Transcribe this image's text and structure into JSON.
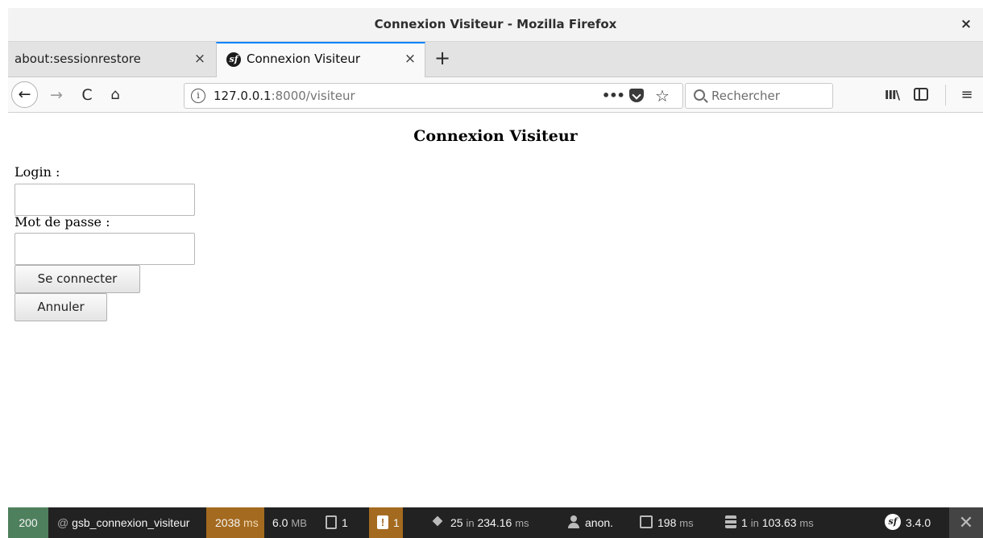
{
  "window": {
    "title": "Connexion Visiteur - Mozilla Firefox",
    "close_glyph": "×"
  },
  "tabs": [
    {
      "label": "about:sessionrestore",
      "active": false
    },
    {
      "label": "Connexion Visiteur",
      "active": true
    }
  ],
  "tab_close_glyph": "×",
  "new_tab_glyph": "+",
  "nav": {
    "url_host": "127.0.0.1",
    "url_path": ":8000/visiteur",
    "search_placeholder": "Rechercher",
    "more_glyph": "•••",
    "star_glyph": "☆",
    "back_glyph": "←",
    "forward_glyph": "→",
    "reload_glyph": "C",
    "home_glyph": "⌂",
    "library_glyph": "III\\",
    "menu_glyph": "≡",
    "info_glyph": "i"
  },
  "page": {
    "title": "Connexion Visiteur",
    "login_label": "Login :",
    "login_value": "",
    "password_label": "Mot de passe :",
    "password_value": "",
    "submit_label": "Se connecter",
    "cancel_label": "Annuler"
  },
  "profiler": {
    "status": "200",
    "route_prefix": "@",
    "route": "gsb_connexion_visiteur",
    "time_value": "2038",
    "time_unit": "ms",
    "memory_value": "6.0",
    "memory_unit": "MB",
    "logs_count": "1",
    "warnings_count": "1",
    "doctrine_count": "25",
    "doctrine_in": "in",
    "doctrine_time": "234.16",
    "doctrine_unit": "ms",
    "user": "anon.",
    "twig_time": "198",
    "twig_unit": "ms",
    "db_count": "1",
    "db_in": "in",
    "db_time": "103.63",
    "db_unit": "ms",
    "version": "3.4.0",
    "close_glyph": "✕",
    "colors": {
      "ok": "#4f805d",
      "warning": "#a46a1f",
      "bar": "#222222"
    }
  },
  "icons": [
    "info-icon",
    "pocket-icon",
    "star-icon",
    "search-icon",
    "library-icon",
    "sidebar-icon",
    "menu-icon",
    "symfony-icon"
  ]
}
